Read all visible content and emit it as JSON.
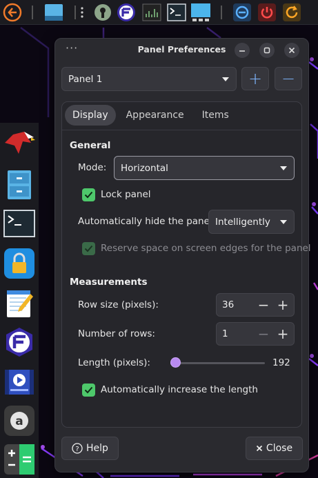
{
  "colors": {
    "accent": "#4ec86b",
    "slider": "#b88af0",
    "link_blue": "#7fb6ff",
    "dialog_bg": "#2a2a2f"
  },
  "top_panel": {
    "icons": [
      "menu-logo-icon",
      "desktop-icon",
      "dots-icon",
      "keyhole-icon",
      "app-f-icon",
      "terminal-monitor-icon",
      "terminal-icon",
      "workspace-icon",
      "logout-icon",
      "power-icon",
      "restart-icon"
    ]
  },
  "dock": {
    "icons": [
      "eagle-app-icon",
      "file-cabinet-icon",
      "terminal-icon",
      "lock-icon",
      "notepad-icon",
      "app-f-icon",
      "video-editor-icon",
      "app-a-icon",
      "calculator-icon"
    ]
  },
  "dialog": {
    "title": "Panel Preferences",
    "menu_glyph": "···",
    "panel_select": {
      "value": "Panel 1"
    },
    "add_label": "+",
    "remove_label": "−",
    "tabs": [
      "Display",
      "Appearance",
      "Items"
    ],
    "active_tab": "Display",
    "general": {
      "heading": "General",
      "mode_label": "Mode:",
      "mode_value": "Horizontal",
      "lock_label": "Lock panel",
      "lock_checked": true,
      "autohide_label": "Automatically hide the panel:",
      "autohide_value": "Intelligently",
      "reserve_label": "Reserve space on screen edges for the panel",
      "reserve_checked": true,
      "reserve_enabled": false
    },
    "measurements": {
      "heading": "Measurements",
      "row_size_label": "Row size (pixels):",
      "row_size_value": "36",
      "rows_label": "Number of rows:",
      "rows_value": "1",
      "length_label": "Length (pixels):",
      "length_value": "192",
      "length_slider_fraction": 0.05,
      "auto_length_label": "Automatically increase the length",
      "auto_length_checked": true
    },
    "help_label": "Help",
    "close_label": "Close",
    "minus_glyph": "−",
    "plus_glyph": "+"
  }
}
